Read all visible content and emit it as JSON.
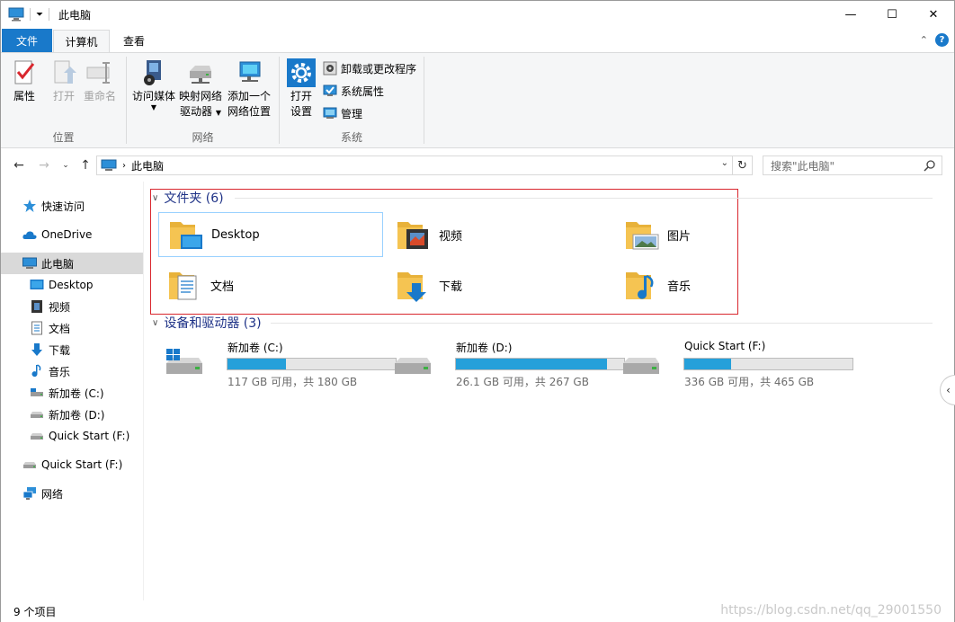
{
  "window": {
    "title": "此电脑",
    "controls": {
      "minimize": "—",
      "maximize": "☐",
      "close": "✕"
    }
  },
  "ribbon_tabs": [
    {
      "label": "文件"
    },
    {
      "label": "计算机"
    },
    {
      "label": "查看"
    }
  ],
  "ribbon": {
    "groups": {
      "location": "位置",
      "network": "网络",
      "system": "系统"
    },
    "buttons": {
      "properties": "属性",
      "open": "打开",
      "rename": "重命名",
      "access_media": "访问媒体",
      "map_drive_1": "映射网络",
      "map_drive_2": "驱动器",
      "add_location_1": "添加一个",
      "add_location_2": "网络位置",
      "open_settings_1": "打开",
      "open_settings_2": "设置",
      "uninstall": "卸载或更改程序",
      "system_properties": "系统属性",
      "manage": "管理"
    }
  },
  "address": {
    "path": "此电脑",
    "search_placeholder": "搜索\"此电脑\""
  },
  "navpane": {
    "items": [
      {
        "label": "快速访问",
        "icon": "star-icon"
      },
      {
        "label": "OneDrive",
        "icon": "cloud-icon"
      },
      {
        "label": "此电脑",
        "icon": "computer-icon"
      },
      {
        "label": "Desktop",
        "icon": "desktop-icon"
      },
      {
        "label": "视频",
        "icon": "video-icon"
      },
      {
        "label": "文档",
        "icon": "document-icon"
      },
      {
        "label": "下载",
        "icon": "download-icon"
      },
      {
        "label": "音乐",
        "icon": "music-icon"
      },
      {
        "label": "新加卷 (C:)",
        "icon": "drive-icon"
      },
      {
        "label": "新加卷 (D:)",
        "icon": "drive-icon"
      },
      {
        "label": "Quick Start (F:)",
        "icon": "drive-icon"
      },
      {
        "label": "Quick Start (F:)",
        "icon": "drive-icon"
      },
      {
        "label": "网络",
        "icon": "network-icon"
      }
    ]
  },
  "content": {
    "folders_header": "文件夹 (6)",
    "folders": [
      {
        "name": "Desktop"
      },
      {
        "name": "视频"
      },
      {
        "name": "图片"
      },
      {
        "name": "文档"
      },
      {
        "name": "下载"
      },
      {
        "name": "音乐"
      }
    ],
    "drives_header": "设备和驱动器 (3)",
    "drives": [
      {
        "name": "新加卷 (C:)",
        "free": "117 GB 可用，共 180 GB",
        "used_fraction": 0.35
      },
      {
        "name": "新加卷 (D:)",
        "free": "26.1 GB 可用，共 267 GB",
        "used_fraction": 0.9
      },
      {
        "name": "Quick Start (F:)",
        "free": "336 GB 可用，共 465 GB",
        "used_fraction": 0.28
      }
    ]
  },
  "status": {
    "item_count": "9 个项目",
    "watermark": "https://blog.csdn.net/qq_29001550"
  },
  "colors": {
    "accent": "#1979ca",
    "drive_fill": "#26a0da",
    "highlight": "#d9272e",
    "folder": "#f5c452"
  }
}
